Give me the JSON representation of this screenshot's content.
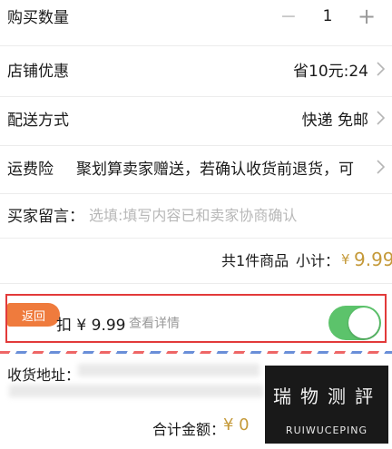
{
  "quantity": {
    "label": "购买数量",
    "minus": "−",
    "value": "1",
    "plus": "+"
  },
  "store_discount": {
    "label": "店铺优惠",
    "value": "省10元:24"
  },
  "delivery": {
    "label": "配送方式",
    "value": "快递 免邮"
  },
  "shipping_insurance": {
    "label": "运费险",
    "value": "聚划算卖家赠送，若确认收货前退货，可..."
  },
  "buyer_message": {
    "label": "买家留言：",
    "placeholder": "选填:填写内容已和卖家协商确认"
  },
  "subtotal": {
    "count_text": "共1件商品",
    "label": "小计：",
    "currency": "¥",
    "amount": "9.99"
  },
  "discount_row": {
    "back_button": "返回",
    "text": "扣 ¥ 9.99",
    "details_link": "查看详情",
    "toggle_on": true
  },
  "address": {
    "label": "收货地址："
  },
  "total": {
    "label": "合计金额：",
    "value": "¥ 0"
  },
  "watermark": {
    "chars": [
      "瑞",
      "物",
      "测",
      "評"
    ],
    "subtitle": "RUIWUCEPING"
  },
  "colors": {
    "accent_price": "#c59a3a",
    "highlight_border": "#e23a3a",
    "toggle_on": "#5cc36b",
    "back_button": "#ef7b3d"
  },
  "icons": [
    "minus-icon",
    "plus-icon",
    "chevron-right-icon"
  ]
}
